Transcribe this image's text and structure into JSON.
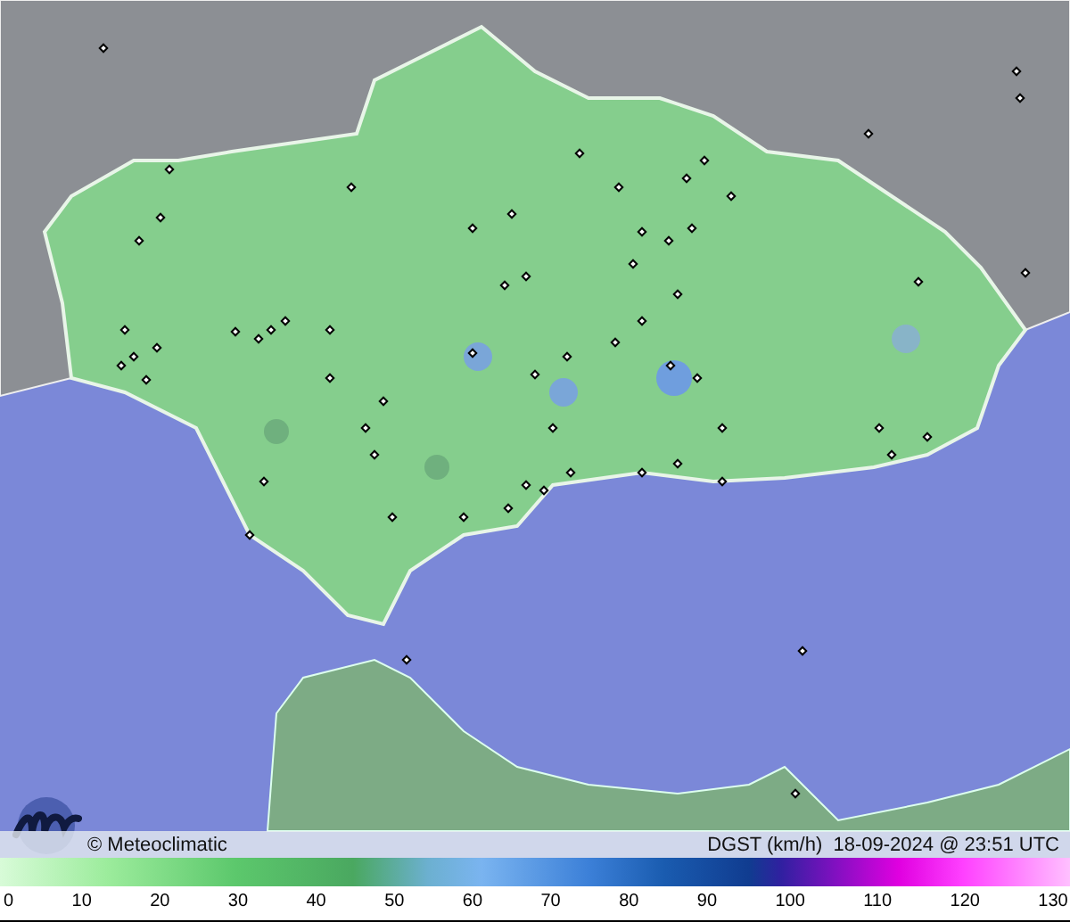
{
  "map": {
    "brand": "© Meteoclimatic",
    "caption": "DGST (km/h)  18-09-2024 @ 23:51 UTC"
  },
  "legend": {
    "ticks": [
      "0",
      "10",
      "20",
      "30",
      "40",
      "50",
      "60",
      "70",
      "80",
      "90",
      "100",
      "110",
      "120",
      "130"
    ]
  }
}
